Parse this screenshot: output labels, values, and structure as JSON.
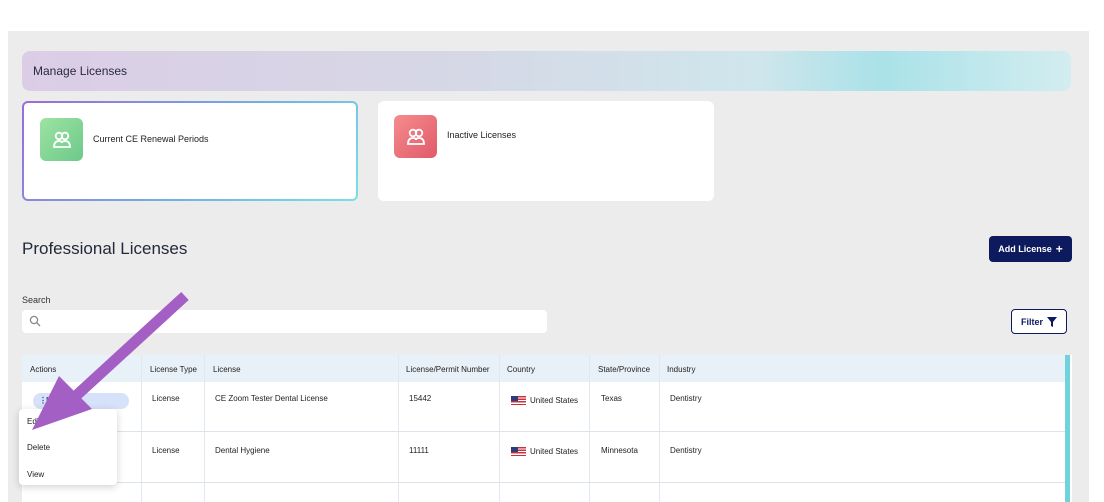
{
  "banner": {
    "title": "Manage Licenses"
  },
  "cards": {
    "current": {
      "label": "Current CE Renewal Periods",
      "icon": "people-icon"
    },
    "inactive": {
      "label": "Inactive Licenses",
      "icon": "people-icon"
    }
  },
  "section": {
    "title": "Professional Licenses"
  },
  "buttons": {
    "add_license": "Add License",
    "add_symbol": "+",
    "filter": "Filter"
  },
  "search": {
    "label": "Search",
    "placeholder": ""
  },
  "table": {
    "headers": [
      "Actions",
      "License Type",
      "License",
      "License/Permit Number",
      "Country",
      "State/Province",
      "Industry"
    ],
    "rows": [
      {
        "type": "License",
        "license": "CE Zoom Tester Dental License",
        "number": "15442",
        "country": "United States",
        "state": "Texas",
        "industry": "Dentistry"
      },
      {
        "type": "License",
        "license": "Dental Hygiene",
        "number": "11111",
        "country": "United States",
        "state": "Minnesota",
        "industry": "Dentistry"
      }
    ]
  },
  "actions_menu": {
    "pill_label": "Ma",
    "items": [
      "Edit",
      "Delete",
      "View"
    ]
  },
  "colors": {
    "primary": "#0d1a5e",
    "arrow": "#a45fc4",
    "accent": "#6fd3dc"
  }
}
